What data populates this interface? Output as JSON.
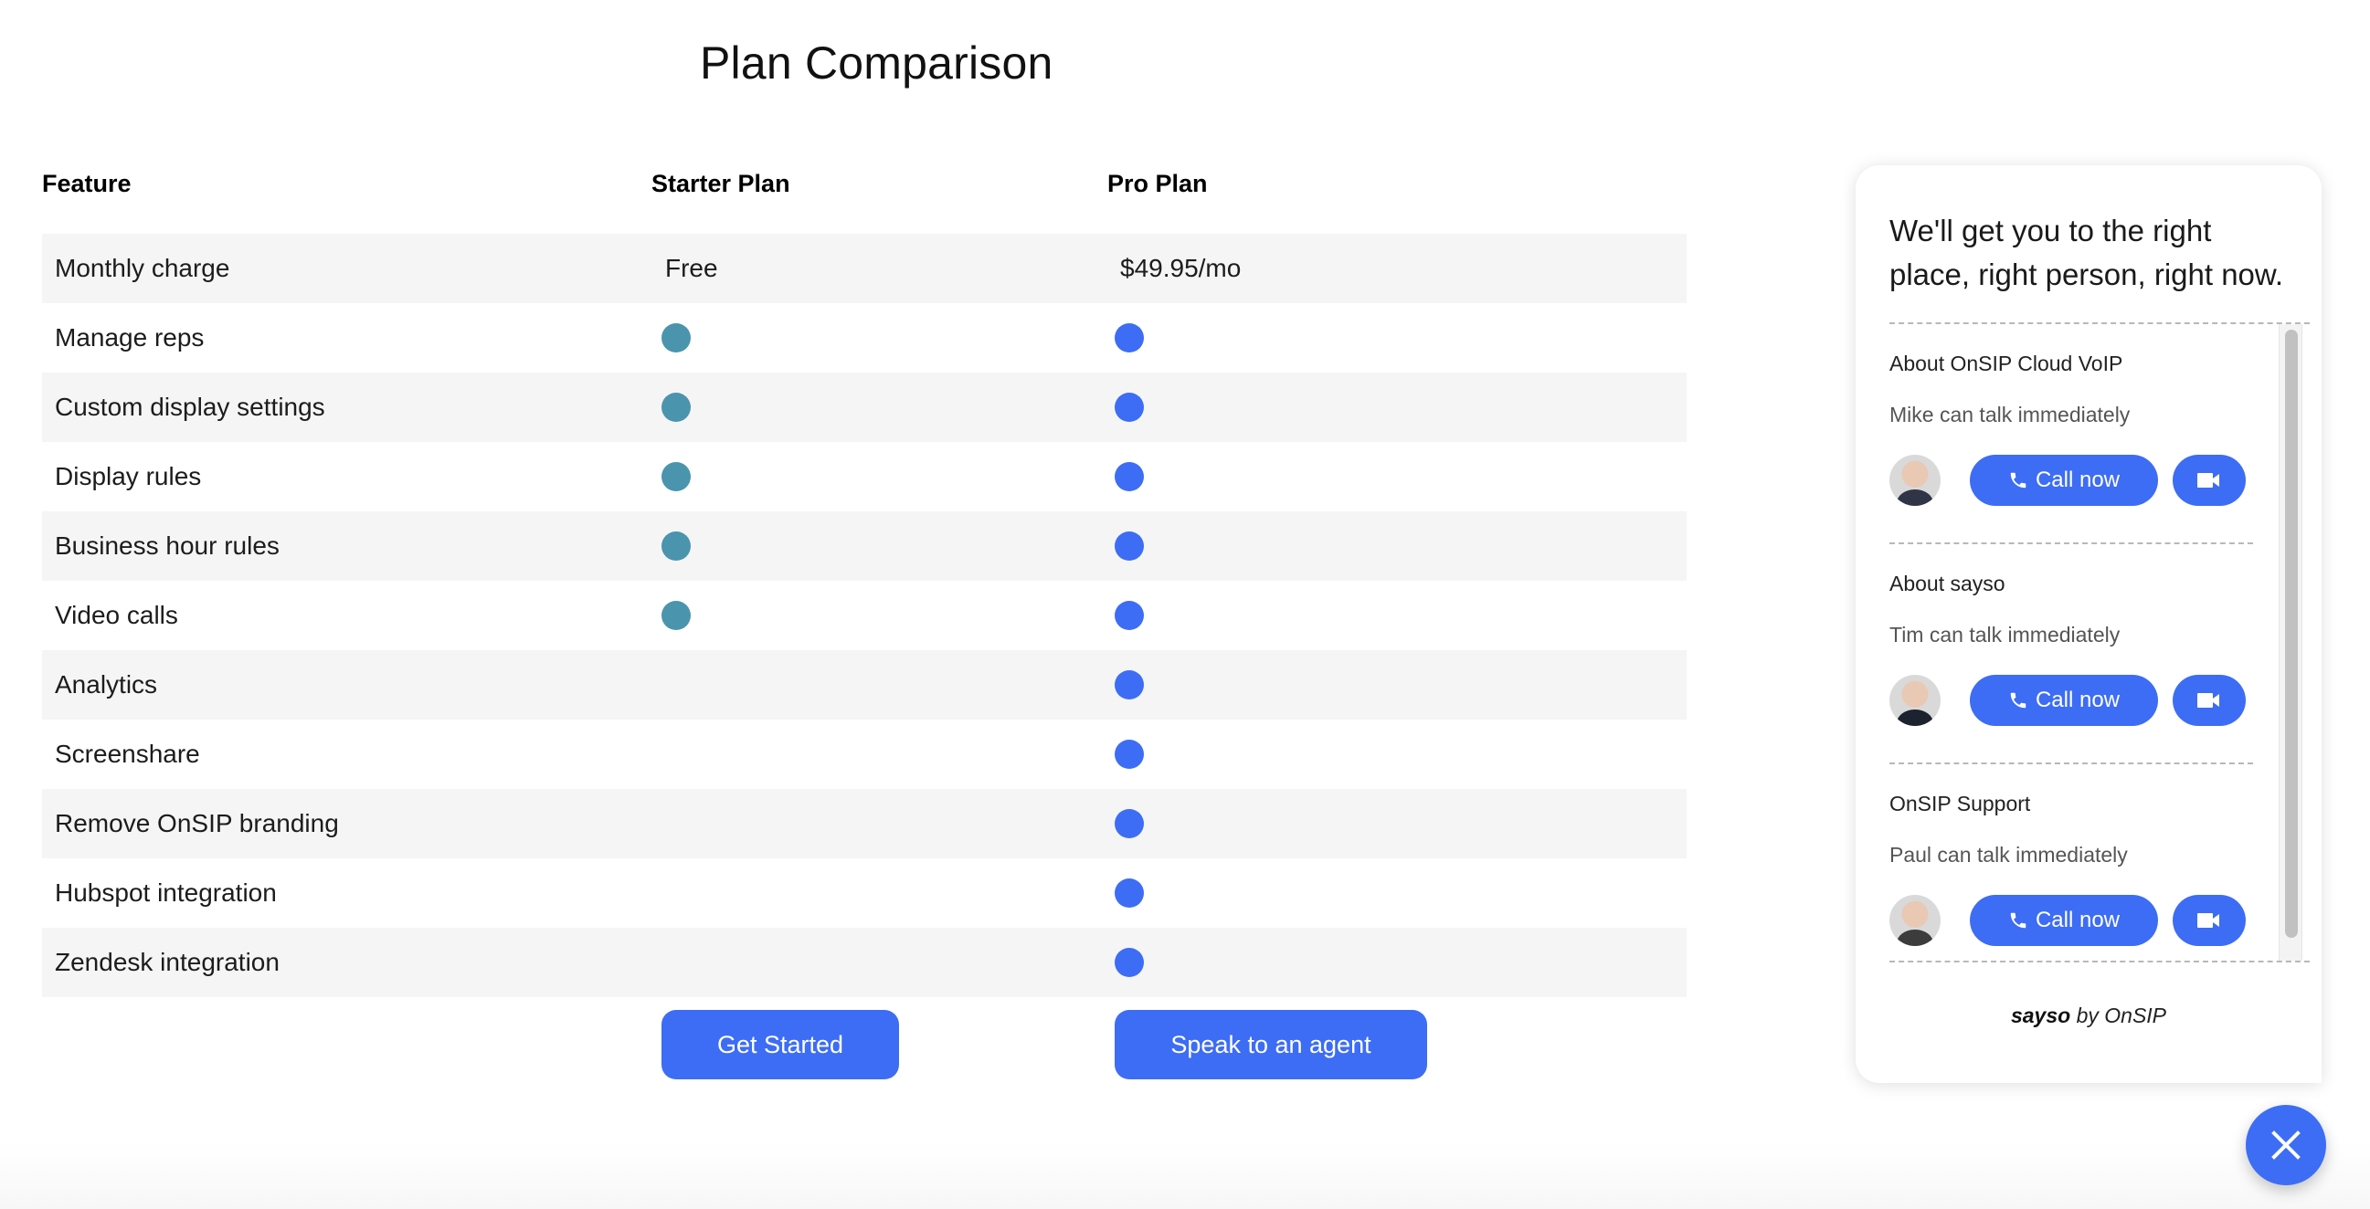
{
  "page": {
    "title": "Plan Comparison"
  },
  "table": {
    "headers": {
      "feature": "Feature",
      "starter": "Starter Plan",
      "pro": "Pro Plan"
    },
    "pricing_row": {
      "feature": "Monthly charge",
      "starter": "Free",
      "pro": "$49.95/mo"
    },
    "rows": [
      {
        "feature": "Manage reps",
        "starter": true,
        "pro": true
      },
      {
        "feature": "Custom display settings",
        "starter": true,
        "pro": true
      },
      {
        "feature": "Display rules",
        "starter": true,
        "pro": true
      },
      {
        "feature": "Business hour rules",
        "starter": true,
        "pro": true
      },
      {
        "feature": "Video calls",
        "starter": true,
        "pro": true
      },
      {
        "feature": "Analytics",
        "starter": false,
        "pro": true
      },
      {
        "feature": "Screenshare",
        "starter": false,
        "pro": true
      },
      {
        "feature": "Remove OnSIP branding",
        "starter": false,
        "pro": true
      },
      {
        "feature": "Hubspot integration",
        "starter": false,
        "pro": true
      },
      {
        "feature": "Zendesk integration",
        "starter": false,
        "pro": true
      }
    ],
    "colors": {
      "starter_dot": "#4a94ae",
      "pro_dot": "#3d6df5"
    }
  },
  "actions": {
    "get_started": "Get Started",
    "speak_to_agent": "Speak to an agent"
  },
  "widget": {
    "headline": "We'll get you to the right place, right person, right now.",
    "sections": [
      {
        "title": "About OnSIP Cloud VoIP",
        "status": "Mike can talk immediately",
        "agent": "Mike",
        "call_label": "Call now"
      },
      {
        "title": "About sayso",
        "status": "Tim can talk immediately",
        "agent": "Tim",
        "call_label": "Call now"
      },
      {
        "title": "OnSIP Support",
        "status": "Paul can talk immediately",
        "agent": "Paul",
        "call_label": "Call now"
      }
    ],
    "footer": {
      "brand": "sayso",
      "suffix": " by OnSIP"
    },
    "accent_color": "#3d6df5"
  }
}
